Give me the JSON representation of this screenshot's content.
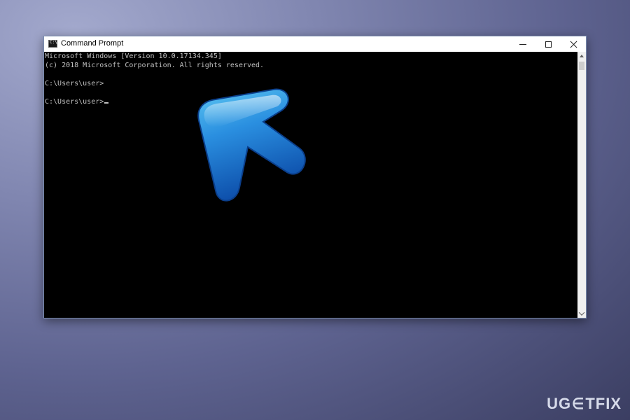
{
  "window": {
    "title": "Command Prompt"
  },
  "console": {
    "lines": [
      "Microsoft Windows [Version 10.0.17134.345]",
      "(c) 2018 Microsoft Corporation. All rights reserved.",
      "C:\\Users\\user>",
      "C:\\Users\\user>"
    ]
  },
  "icons": {
    "app": "command-prompt-icon",
    "minimize": "minimize-icon",
    "maximize": "maximize-icon",
    "close": "close-icon",
    "overlay": "blue-arrow-pointer-icon"
  },
  "colors": {
    "console_bg": "#000000",
    "console_text": "#c0c0c0",
    "arrow_blue": "#1e7fd6",
    "logo": "#d7dbea"
  },
  "watermark": {
    "logo_text": "UGETFIX"
  }
}
